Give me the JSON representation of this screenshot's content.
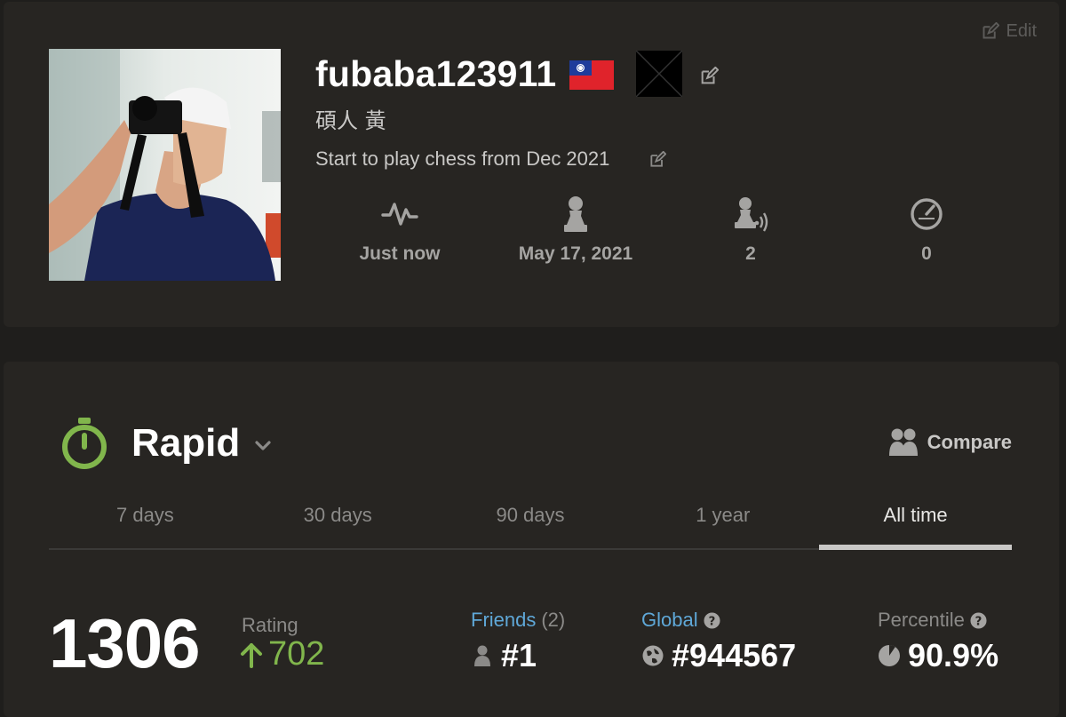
{
  "header": {
    "edit_label": "Edit",
    "username": "fubaba123911",
    "real_name": "碩人 黃",
    "bio": "Start to play chess from Dec 2021",
    "country_flag": "taiwan-flag-icon"
  },
  "stats": [
    {
      "icon": "activity-pulse-icon",
      "value": "Just now"
    },
    {
      "icon": "pawn-person-icon",
      "value": "May 17, 2021"
    },
    {
      "icon": "followers-icon",
      "value": "2"
    },
    {
      "icon": "speedometer-icon",
      "value": "0"
    }
  ],
  "rating_section": {
    "time_control": "Rapid",
    "compare_label": "Compare",
    "tabs": [
      {
        "label": "7 days",
        "active": false
      },
      {
        "label": "30 days",
        "active": false
      },
      {
        "label": "90 days",
        "active": false
      },
      {
        "label": "1 year",
        "active": false
      },
      {
        "label": "All time",
        "active": true
      }
    ],
    "rating": "1306",
    "rating_label": "Rating",
    "rating_change": "702",
    "friends": {
      "label": "Friends",
      "count": "(2)",
      "rank": "#1"
    },
    "global": {
      "label": "Global",
      "rank": "#944567"
    },
    "percentile": {
      "label": "Percentile",
      "value": "90.9%"
    }
  },
  "colors": {
    "background": "#1f1e1c",
    "card": "#272522",
    "accent_green": "#81b64c",
    "link_blue": "#5fa8d8"
  }
}
